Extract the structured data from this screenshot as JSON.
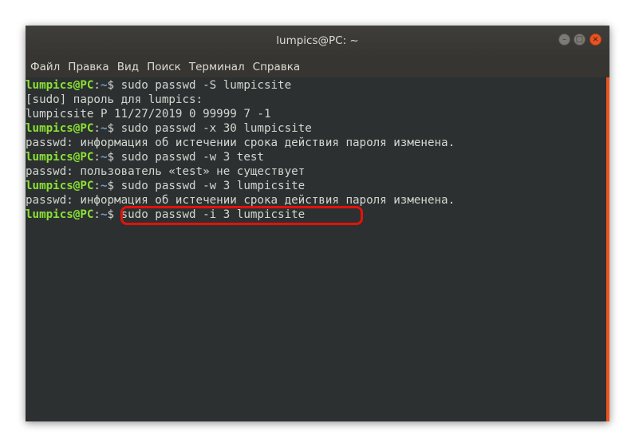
{
  "window": {
    "title": "lumpics@PC: ~",
    "buttons": {
      "minimize_icon": "minus",
      "maximize_icon": "square",
      "close_icon": "x"
    }
  },
  "menubar": {
    "items": [
      "Файл",
      "Правка",
      "Вид",
      "Поиск",
      "Терминал",
      "Справка"
    ]
  },
  "prompt": {
    "user": "lumpics@PC",
    "path": "~",
    "sign": "$"
  },
  "terminal": {
    "lines": [
      {
        "type": "cmd",
        "text": " sudo passwd -S lumpicsite"
      },
      {
        "type": "out",
        "text": "[sudo] пароль для lumpics:"
      },
      {
        "type": "out",
        "text": "lumpicsite P 11/27/2019 0 99999 7 -1"
      },
      {
        "type": "cmd",
        "text": " sudo passwd -x 30 lumpicsite"
      },
      {
        "type": "out",
        "text": "passwd: информация об истечении срока действия пароля изменена."
      },
      {
        "type": "cmd",
        "text": " sudo passwd -w 3 test"
      },
      {
        "type": "out",
        "text": "passwd: пользователь «test» не существует"
      },
      {
        "type": "cmd",
        "text": " sudo passwd -w 3 lumpicsite"
      },
      {
        "type": "out",
        "text": "passwd: информация об истечении срока действия пароля изменена."
      },
      {
        "type": "cmd",
        "text": " sudo passwd -i 3 lumpicsite"
      }
    ]
  },
  "colors": {
    "prompt_user": "#8ae234",
    "prompt_path": "#729fcf",
    "terminal_bg": "#2d3031",
    "scrollbar": "#e95420",
    "highlight": "#e3120b"
  }
}
